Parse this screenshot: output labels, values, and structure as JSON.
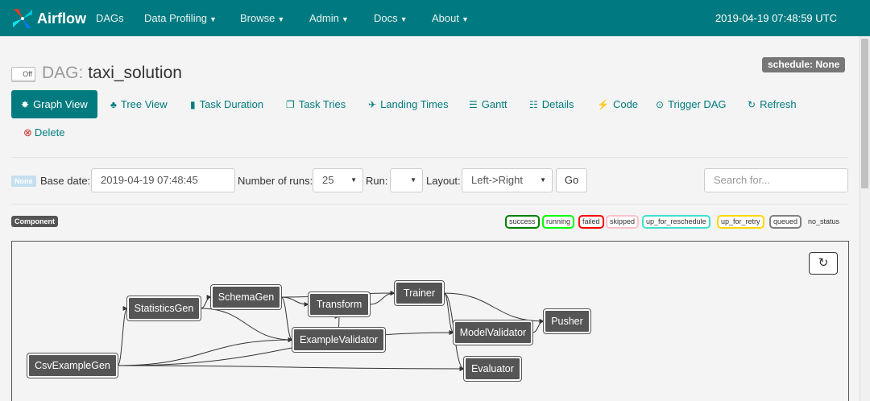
{
  "navbar": {
    "brand": "Airflow",
    "items": [
      {
        "label": "DAGs",
        "caret": false
      },
      {
        "label": "Data Profiling",
        "caret": true
      },
      {
        "label": "Browse",
        "caret": true
      },
      {
        "label": "Admin",
        "caret": true
      },
      {
        "label": "Docs",
        "caret": true
      },
      {
        "label": "About",
        "caret": true
      }
    ],
    "timestamp": "2019-04-19 07:48:59 UTC"
  },
  "dag": {
    "toggle_label": "Off",
    "prefix": "DAG:",
    "name": "taxi_solution",
    "schedule": "schedule: None"
  },
  "tabs": [
    {
      "label": "Graph View",
      "icon": "asterisk-icon",
      "active": true
    },
    {
      "label": "Tree View",
      "icon": "tree-icon"
    },
    {
      "label": "Task Duration",
      "icon": "bar-chart-icon"
    },
    {
      "label": "Task Tries",
      "icon": "duplicate-icon"
    },
    {
      "label": "Landing Times",
      "icon": "plane-icon"
    },
    {
      "label": "Gantt",
      "icon": "align-left-icon"
    },
    {
      "label": "Details",
      "icon": "list-icon"
    },
    {
      "label": "Code",
      "icon": "flash-icon"
    },
    {
      "label": "Trigger DAG",
      "icon": "play-circle-icon"
    },
    {
      "label": "Refresh",
      "icon": "refresh-icon"
    }
  ],
  "delete_label": "Delete",
  "filters": {
    "none_badge": "None",
    "base_date_label": "Base date:",
    "base_date_value": "2019-04-19 07:48:45",
    "num_runs_label": "Number of runs:",
    "num_runs_value": "25",
    "run_label": "Run:",
    "run_value": "",
    "layout_label": "Layout:",
    "layout_value": "Left->Right",
    "go_label": "Go",
    "search_placeholder": "Search for..."
  },
  "component_badge": "Component",
  "legend": [
    {
      "label": "success",
      "color": "#008000"
    },
    {
      "label": "running",
      "color": "#00ff00"
    },
    {
      "label": "failed",
      "color": "#ff0000"
    },
    {
      "label": "skipped",
      "color": "#ffc0cb"
    },
    {
      "label": "up_for_reschedule",
      "color": "#40e0d0"
    },
    {
      "label": "up_for_retry",
      "color": "#ffd700"
    },
    {
      "label": "queued",
      "color": "#808080"
    },
    {
      "label": "no_status",
      "color": ""
    }
  ],
  "graph": {
    "nodes": [
      {
        "id": "CsvExampleGen",
        "label": "CsvExampleGen"
      },
      {
        "id": "StatisticsGen",
        "label": "StatisticsGen"
      },
      {
        "id": "SchemaGen",
        "label": "SchemaGen"
      },
      {
        "id": "Transform",
        "label": "Transform"
      },
      {
        "id": "ExampleValidator",
        "label": "ExampleValidator"
      },
      {
        "id": "Trainer",
        "label": "Trainer"
      },
      {
        "id": "ModelValidator",
        "label": "ModelValidator"
      },
      {
        "id": "Evaluator",
        "label": "Evaluator"
      },
      {
        "id": "Pusher",
        "label": "Pusher"
      }
    ],
    "edges": [
      [
        "CsvExampleGen",
        "StatisticsGen"
      ],
      [
        "CsvExampleGen",
        "ExampleValidator"
      ],
      [
        "CsvExampleGen",
        "ModelValidator"
      ],
      [
        "CsvExampleGen",
        "Evaluator"
      ],
      [
        "StatisticsGen",
        "SchemaGen"
      ],
      [
        "StatisticsGen",
        "ExampleValidator"
      ],
      [
        "SchemaGen",
        "Transform"
      ],
      [
        "SchemaGen",
        "ExampleValidator"
      ],
      [
        "SchemaGen",
        "Trainer"
      ],
      [
        "Transform",
        "Trainer"
      ],
      [
        "ExampleValidator",
        "Transform"
      ],
      [
        "Trainer",
        "ModelValidator"
      ],
      [
        "Trainer",
        "Evaluator"
      ],
      [
        "Trainer",
        "Pusher"
      ],
      [
        "ModelValidator",
        "Pusher"
      ]
    ]
  },
  "colors": {
    "navbar": "#007a80",
    "accent": "#017b7f",
    "node": "#555555"
  }
}
